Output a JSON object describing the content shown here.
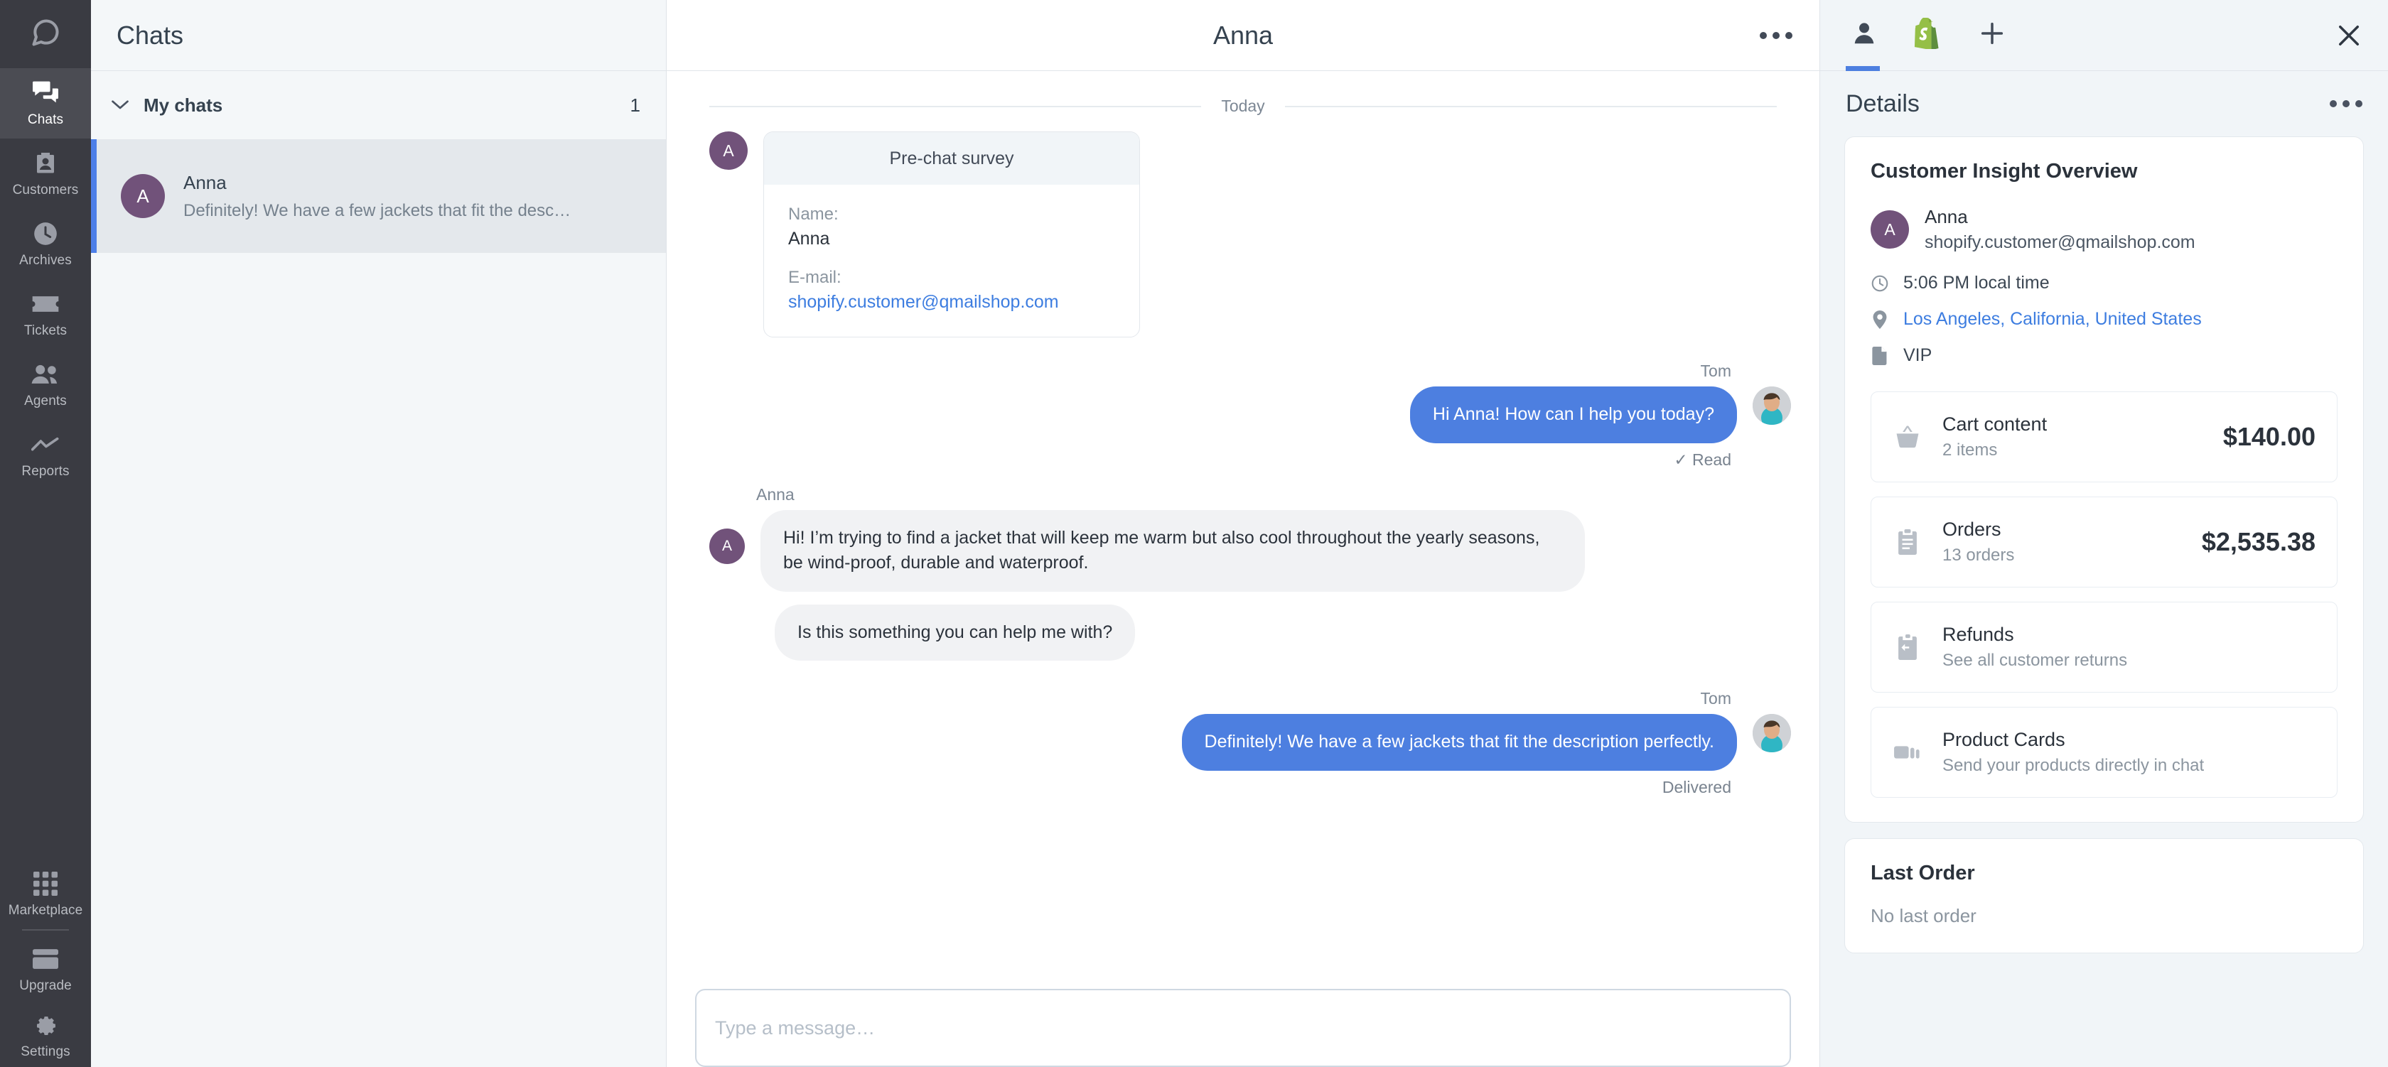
{
  "nav": {
    "logo_icon": "chat-bubble-logo",
    "items": [
      {
        "label": "Chats",
        "icon": "chats-icon",
        "active": true
      },
      {
        "label": "Customers",
        "icon": "customers-icon",
        "active": false
      },
      {
        "label": "Archives",
        "icon": "clock-icon",
        "active": false
      },
      {
        "label": "Tickets",
        "icon": "ticket-icon",
        "active": false
      },
      {
        "label": "Agents",
        "icon": "agents-icon",
        "active": false
      },
      {
        "label": "Reports",
        "icon": "chart-line-icon",
        "active": false
      }
    ],
    "bottom_items": [
      {
        "label": "Marketplace",
        "icon": "grid-icon"
      },
      {
        "label": "Upgrade",
        "icon": "card-icon"
      },
      {
        "label": "Settings",
        "icon": "gear-icon"
      }
    ]
  },
  "chatlist": {
    "title": "Chats",
    "section_label": "My chats",
    "section_count": "1",
    "rows": [
      {
        "avatar_initial": "A",
        "name": "Anna",
        "snippet": "Definitely! We have a few jackets that fit the desc…"
      }
    ]
  },
  "conversation": {
    "title": "Anna",
    "more_icon": "more-horizontal-icon",
    "day_label": "Today",
    "survey": {
      "header": "Pre-chat survey",
      "name_label": "Name:",
      "name_value": "Anna",
      "email_label": "E-mail:",
      "email_value": "shopify.customer@qmailshop.com",
      "avatar_initial": "A"
    },
    "messages": [
      {
        "sender": "Tom",
        "direction": "out",
        "text": "Hi Anna! How can I help you today?",
        "receipt": "✓ Read"
      },
      {
        "sender": "Anna",
        "direction": "in",
        "avatar_initial": "A",
        "text": "Hi! I’m trying to find a jacket that will keep me warm but also cool throughout the yearly seasons, be wind-proof, durable and waterproof."
      },
      {
        "sender": "",
        "direction": "in",
        "text": "Is this something you can help me with?"
      },
      {
        "sender": "Tom",
        "direction": "out",
        "text": "Definitely! We have a few jackets that fit the description perfectly.",
        "receipt": "Delivered"
      }
    ],
    "composer_placeholder": "Type a message…"
  },
  "details": {
    "tabs": [
      {
        "icon": "person-icon",
        "active": true
      },
      {
        "icon": "shopify-icon",
        "active": false
      },
      {
        "icon": "plus-icon",
        "active": false
      }
    ],
    "close_icon": "close-icon",
    "title": "Details",
    "more_icon": "more-horizontal-icon",
    "customer_card": {
      "title": "Customer Insight Overview",
      "avatar_initial": "A",
      "name": "Anna",
      "email": "shopify.customer@qmailshop.com",
      "local_time": "5:06 PM local time",
      "location": "Los Angeles, California, United States",
      "tag": "VIP",
      "tiles": [
        {
          "icon": "basket-icon",
          "title": "Cart content",
          "sub": "2 items",
          "value": "$140.00"
        },
        {
          "icon": "clipboard-icon",
          "title": "Orders",
          "sub": "13 orders",
          "value": "$2,535.38"
        },
        {
          "icon": "refund-icon",
          "title": "Refunds",
          "sub": "See all customer returns",
          "value": ""
        },
        {
          "icon": "cards-icon",
          "title": "Product Cards",
          "sub": "Send your products directly in chat",
          "value": ""
        }
      ]
    },
    "last_order_card": {
      "title": "Last Order",
      "body": "No last order"
    }
  },
  "colors": {
    "accent_blue": "#4d7fe0",
    "nav_dark": "#3a3b42",
    "avatar_purple": "#71527a",
    "panel_bg": "#f1f5f8",
    "link_blue": "#3d7de0"
  }
}
